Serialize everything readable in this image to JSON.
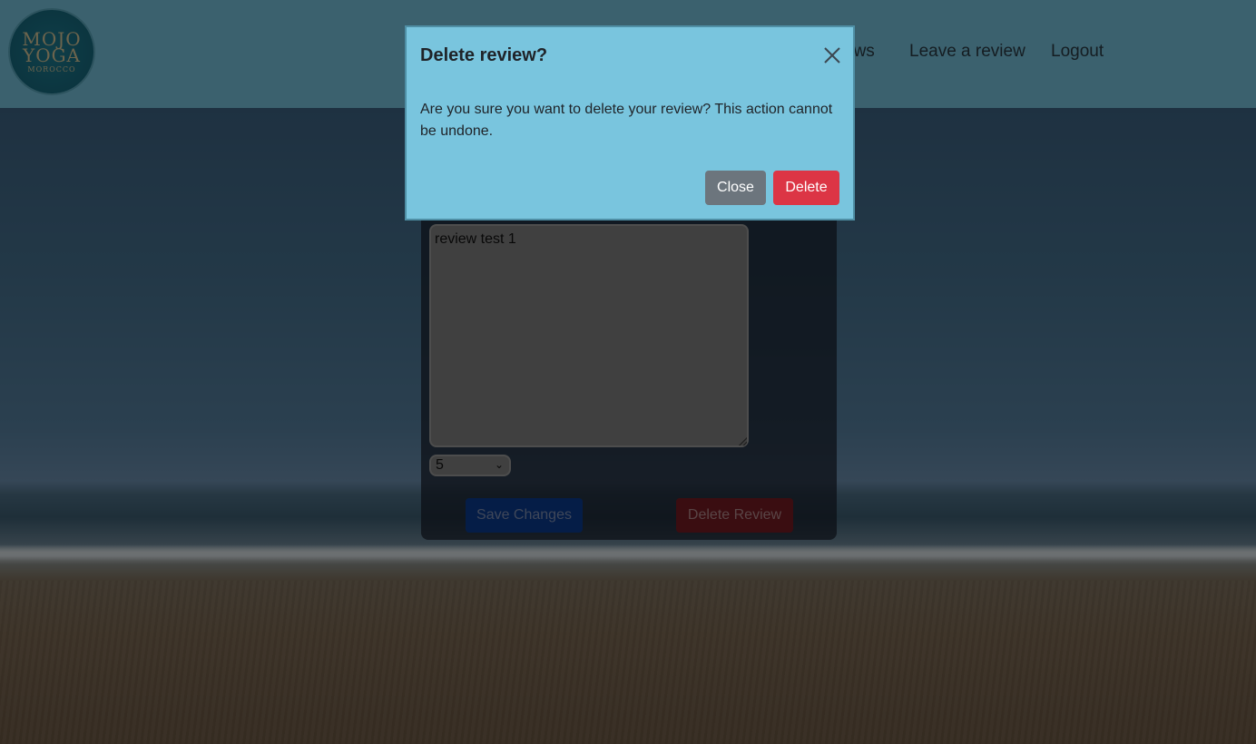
{
  "logo": {
    "line1": "MOJO",
    "line2": "YOGA",
    "line3": "MOROCCO"
  },
  "nav": {
    "items": [
      {
        "label": "ews"
      },
      {
        "label": "Leave a review"
      },
      {
        "label": "Logout"
      }
    ]
  },
  "edit_form": {
    "review_text": "review test 1",
    "rating_value": "5",
    "save_label": "Save Changes",
    "delete_label": "Delete Review"
  },
  "modal": {
    "title": "Delete review?",
    "body": "Are you sure you want to delete your review? This action cannot be undone.",
    "close_label": "Close",
    "delete_label": "Delete"
  },
  "colors": {
    "navbar": "#76c3dc",
    "modal_bg": "#79c5de",
    "danger": "#dc3545",
    "secondary": "#6c757d",
    "primary": "#0d6efd"
  }
}
